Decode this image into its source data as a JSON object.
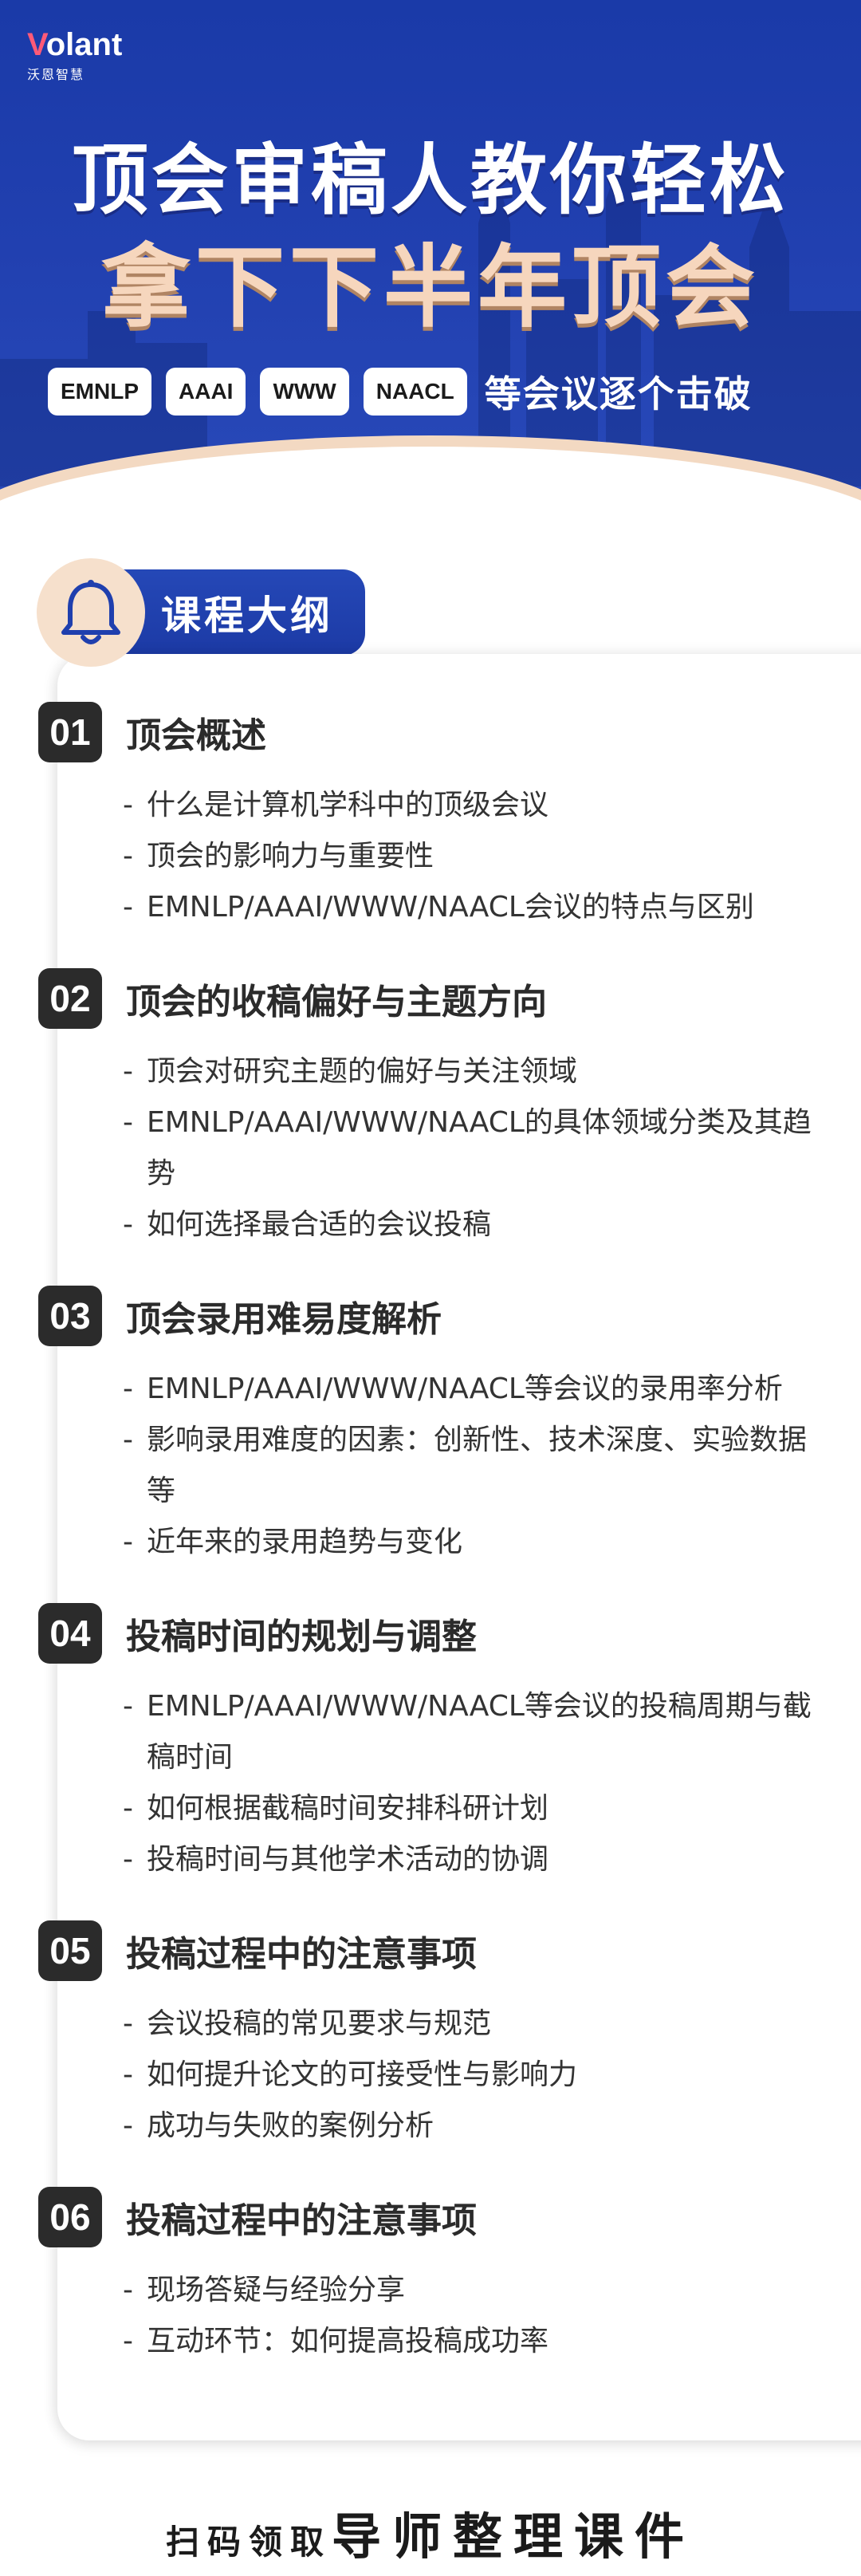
{
  "brand": {
    "logo_v": "V",
    "logo_rest": "olant",
    "subtitle": "沃恩智慧"
  },
  "hero": {
    "title_line1": "顶会审稿人教你轻松",
    "title_line2": "拿下下半年顶会",
    "conferences": [
      "EMNLP",
      "AAAI",
      "WWW",
      "NAACL"
    ],
    "conferences_suffix": "等会议逐个击破"
  },
  "outline": {
    "label": "课程大纲",
    "icon": "bell-icon"
  },
  "sections": [
    {
      "num": "01",
      "title": "顶会概述",
      "items": [
        "什么是计算机学科中的顶级会议",
        "顶会的影响力与重要性",
        "EMNLP/AAAI/WWW/NAACL会议的特点与区别"
      ]
    },
    {
      "num": "02",
      "title": "顶会的收稿偏好与主题方向",
      "items": [
        "顶会对研究主题的偏好与关注领域",
        "EMNLP/AAAI/WWW/NAACL的具体领域分类及其趋势",
        "如何选择最合适的会议投稿"
      ]
    },
    {
      "num": "03",
      "title": "顶会录用难易度解析",
      "items": [
        "EMNLP/AAAI/WWW/NAACL等会议的录用率分析",
        "影响录用难度的因素：创新性、技术深度、实验数据等",
        "近年来的录用趋势与变化"
      ]
    },
    {
      "num": "04",
      "title": "投稿时间的规划与调整",
      "items": [
        "EMNLP/AAAI/WWW/NAACL等会议的投稿周期与截稿时间",
        "如何根据截稿时间安排科研计划",
        "投稿时间与其他学术活动的协调"
      ]
    },
    {
      "num": "05",
      "title": "投稿过程中的注意事项",
      "items": [
        "会议投稿的常见要求与规范",
        "如何提升论文的可接受性与影响力",
        "成功与失败的案例分析"
      ]
    },
    {
      "num": "06",
      "title": "投稿过程中的注意事项",
      "items": [
        "现场答疑与经验分享",
        "互动环节：如何提高投稿成功率"
      ]
    }
  ],
  "footer": {
    "prefix": "扫码领取",
    "emphasis": "导师整理课件"
  },
  "colors": {
    "primary_blue": "#1f3fae",
    "accent_peach": "#f6d6bd",
    "dark": "#2b2b2b"
  }
}
